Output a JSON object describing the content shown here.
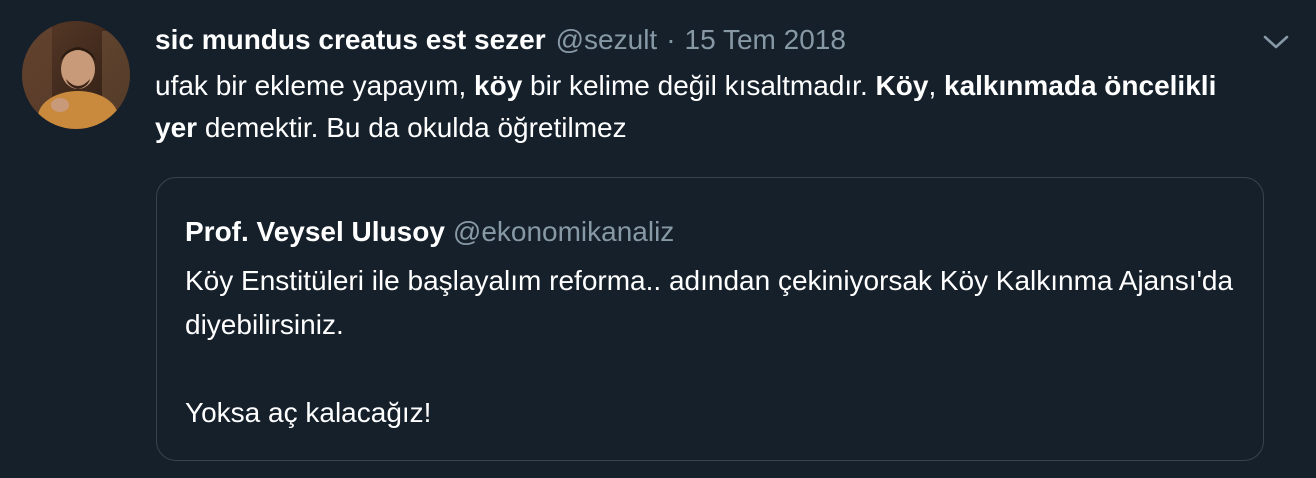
{
  "tweet": {
    "author": {
      "display_name": "sic mundus creatus est sezer",
      "handle": "@sezult"
    },
    "separator": "·",
    "date": "15 Tem 2018",
    "body": {
      "t1": "ufak bir ekleme yapayım, ",
      "b1": "köy",
      "t2": " bir kelime değil kısaltmadır. ",
      "b2": "Köy",
      "t3": ", ",
      "b3": "kalkınmada öncelikli yer",
      "t4": " demektir. Bu da okulda öğretilmez"
    },
    "menu_icon": "chevron-down-icon"
  },
  "quoted_tweet": {
    "display_name": "Prof. Veysel Ulusoy",
    "handle": "@ekonomikanaliz",
    "line1": "Köy Enstitüleri ile başlayalım reforma.. adından çekiniyorsak Köy Kalkınma Ajansı'da diyebilirsiniz.",
    "line2": "Yoksa aç kalacağız!"
  },
  "colors": {
    "background": "#15202b",
    "primary_text": "#ffffff",
    "secondary_text": "#8899a6",
    "border": "#38444d"
  }
}
